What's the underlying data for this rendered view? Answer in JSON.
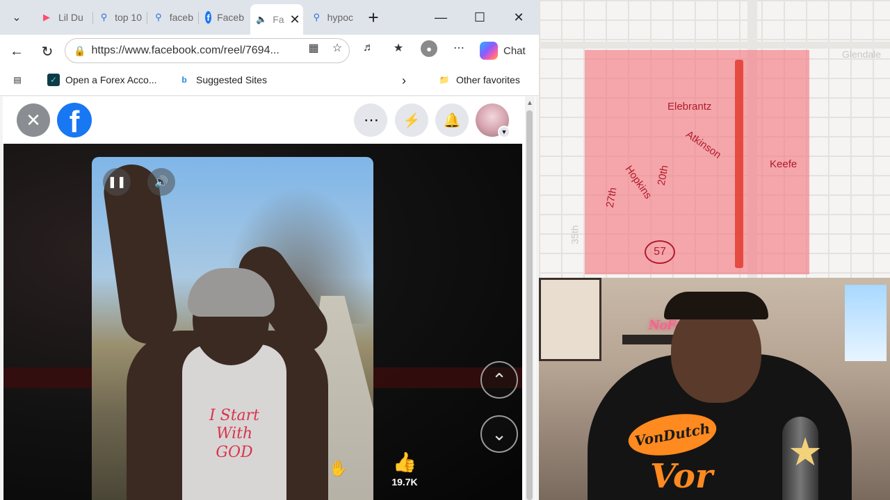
{
  "browser": {
    "tabs": [
      {
        "label": "Lil Du",
        "icon": "youtube-icon",
        "color": "#ff4d6d"
      },
      {
        "label": "top 10",
        "icon": "search-icon",
        "color": "#2b6fd6"
      },
      {
        "label": "faceb",
        "icon": "search-icon",
        "color": "#2b6fd6"
      },
      {
        "label": "Faceb",
        "icon": "facebook-icon",
        "color": "#1877f2"
      },
      {
        "label": "Fa",
        "icon": "speaker-icon",
        "color": "#333333"
      },
      {
        "label": "hypoc",
        "icon": "search-icon",
        "color": "#2b6fd6"
      }
    ],
    "address": {
      "url": "https://www.facebook.com/reel/7694..."
    },
    "chat_label": "Chat",
    "favorites": [
      {
        "label": "Open a Forex Acco...",
        "icon": "forex-icon"
      },
      {
        "label": "Suggested Sites",
        "icon": "bing-icon"
      }
    ],
    "other_favorites": "Other favorites"
  },
  "facebook": {
    "like_count": "19.7K",
    "shirt_text": "I Start With GOD"
  },
  "map": {
    "streets": [
      "Elebrantz",
      "Atkinson",
      "Keefe",
      "Hopkins",
      "27th",
      "20th"
    ],
    "route": "57",
    "faint_labels": [
      "Glendale",
      "35th"
    ]
  },
  "webcam": {
    "neon": "NoFavors",
    "shirt_logo": "VonDutch",
    "shirt_big": "Vor"
  }
}
